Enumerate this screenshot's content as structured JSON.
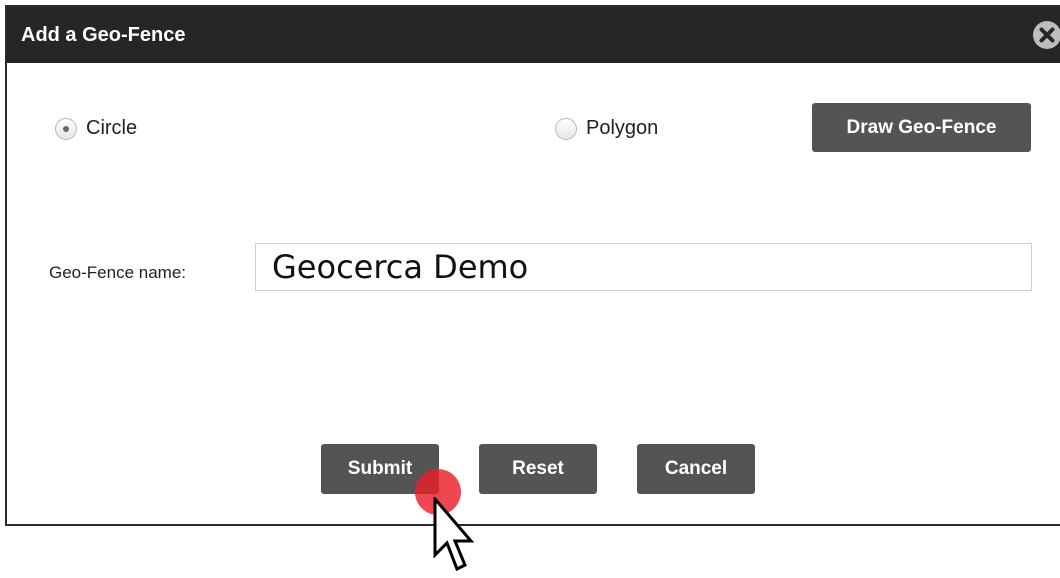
{
  "dialog": {
    "title": "Add a Geo-Fence",
    "close_icon": "close-circle-icon"
  },
  "shape_options": {
    "selected": "Circle",
    "circle_label": "Circle",
    "polygon_label": "Polygon",
    "draw_button_label": "Draw Geo-Fence"
  },
  "form": {
    "name_label": "Geo-Fence name:",
    "name_value": "Geocerca Demo"
  },
  "actions": {
    "submit_label": "Submit",
    "reset_label": "Reset",
    "cancel_label": "Cancel"
  },
  "overlay": {
    "pointer_icon": "mouse-pointer-icon",
    "click_indicator_color": "#eb1e28"
  },
  "colors": {
    "titlebar": "#262626",
    "button": "#545454",
    "button_text": "#ffffff"
  }
}
